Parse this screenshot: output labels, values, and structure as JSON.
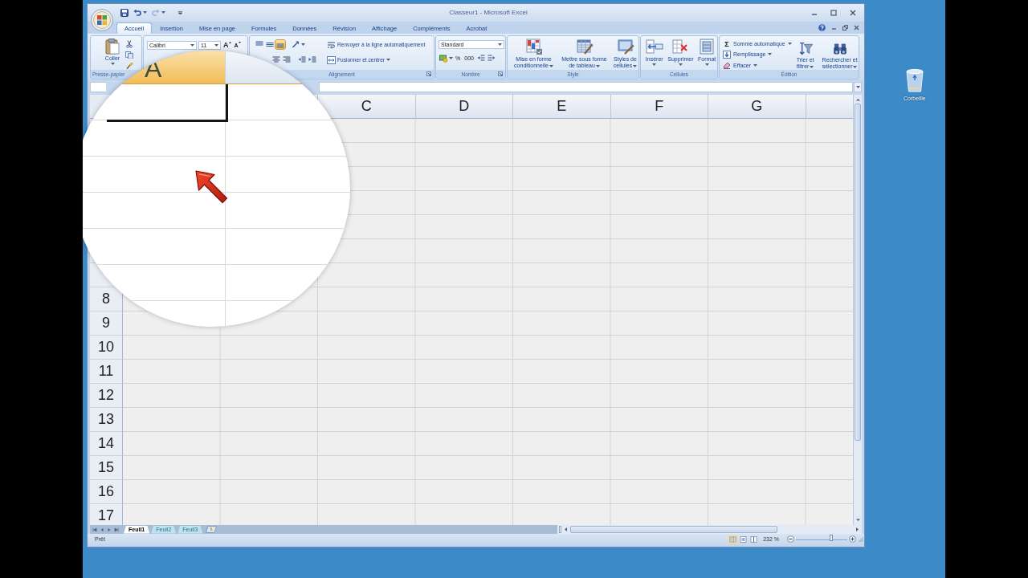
{
  "window": {
    "title": "Classeur1 - Microsoft Excel"
  },
  "quick_access": [
    {
      "kind": "save",
      "disabled": false
    },
    {
      "kind": "undo",
      "disabled": false
    },
    {
      "kind": "redo",
      "disabled": true
    }
  ],
  "ribbon_tabs": [
    {
      "label": "Accueil",
      "selected": true
    },
    {
      "label": "Insertion",
      "selected": false
    },
    {
      "label": "Mise en page",
      "selected": false
    },
    {
      "label": "Formules",
      "selected": false
    },
    {
      "label": "Données",
      "selected": false
    },
    {
      "label": "Révision",
      "selected": false
    },
    {
      "label": "Affichage",
      "selected": false
    },
    {
      "label": "Compléments",
      "selected": false
    },
    {
      "label": "Acrobat",
      "selected": false
    }
  ],
  "clipboard": {
    "paste_label": "Coller",
    "group_label": "Presse-papier"
  },
  "font": {
    "family": "Calibri",
    "size": "11",
    "grow_label": "A",
    "shrink_label": "A"
  },
  "alignment": {
    "vertical": [
      {
        "kind": "top",
        "selected": false
      },
      {
        "kind": "middle",
        "selected": false
      },
      {
        "kind": "bottom",
        "selected": true
      }
    ],
    "wrap_label": "Renvoyer à la ligne automatiquement",
    "merge_label": "Fusionner et centrer",
    "group_label": "Alignement"
  },
  "number": {
    "format": "Standard",
    "percent_label": "%",
    "thousands_label": "000",
    "group_label": "Nombre"
  },
  "style": {
    "buttons": [
      {
        "kind": "conditional",
        "label": "Mise en forme conditionnelle"
      },
      {
        "kind": "table",
        "label": "Mettre sous forme de tableau"
      },
      {
        "kind": "cell_styles",
        "label": "Styles de cellules"
      }
    ],
    "group_label": "Style"
  },
  "cells": {
    "buttons": [
      {
        "kind": "insert",
        "label": "Insérer"
      },
      {
        "kind": "delete",
        "label": "Supprimer"
      },
      {
        "kind": "format",
        "label": "Format"
      }
    ],
    "group_label": "Cellules"
  },
  "editing": {
    "small_buttons": [
      {
        "kind": "sum",
        "icon": "Σ",
        "label": "Somme automatique"
      },
      {
        "kind": "fill",
        "label": "Remplissage"
      },
      {
        "kind": "clear",
        "label": "Effacer"
      }
    ],
    "big_buttons": [
      {
        "kind": "sort",
        "label": "Trier et filtrer"
      },
      {
        "kind": "find",
        "label": "Rechercher et sélectionner"
      }
    ],
    "group_label": "Édition"
  },
  "magnifier": {
    "column_header": "A"
  },
  "grid": {
    "column_headers": [
      "C",
      "D",
      "E",
      "F",
      "G"
    ],
    "row_headers": [
      "8",
      "9",
      "10",
      "11",
      "12",
      "13",
      "14",
      "15",
      "16",
      "17"
    ]
  },
  "sheet_tabs": [
    {
      "label": "Feuil1",
      "selected": true
    },
    {
      "label": "Feuil2",
      "selected": false
    },
    {
      "label": "Feuil3",
      "selected": false
    }
  ],
  "status_bar": {
    "status": "Prêt",
    "views": [
      {
        "kind": "normal",
        "selected": true
      },
      {
        "kind": "page_layout",
        "selected": false
      },
      {
        "kind": "page_break",
        "selected": false
      }
    ],
    "zoom": "232 %",
    "zoom_slider": {
      "level": 0.68
    }
  },
  "desktop_icons": [
    {
      "label": "Corbeille"
    }
  ]
}
